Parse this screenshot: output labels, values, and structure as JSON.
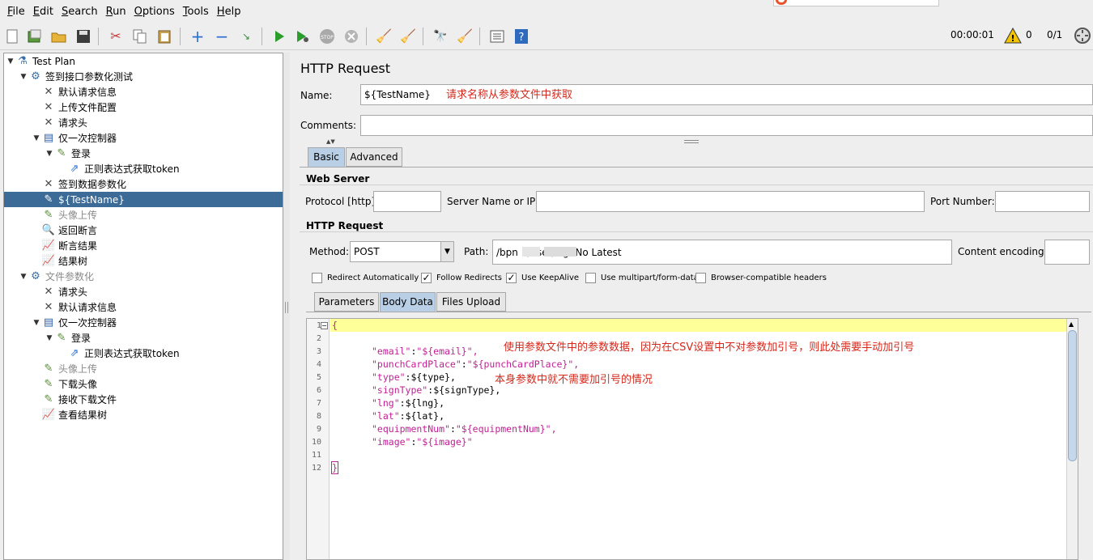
{
  "menu": [
    {
      "key": "F",
      "rest": "ile"
    },
    {
      "key": "E",
      "rest": "dit"
    },
    {
      "key": "S",
      "rest": "earch"
    },
    {
      "key": "R",
      "rest": "un"
    },
    {
      "key": "O",
      "rest": "ptions"
    },
    {
      "key": "T",
      "rest": "ools"
    },
    {
      "key": "H",
      "rest": "elp"
    }
  ],
  "toolbar": {
    "timer": "00:00:01",
    "warnings": "0",
    "threads": "0/1",
    "stop_label": "STOP"
  },
  "tree": [
    {
      "label": "Test Plan",
      "icon": "flask-icon",
      "glyph": "⚗",
      "toggle": "▼",
      "indent": 0
    },
    {
      "label": "签到接口参数化测试",
      "icon": "gear-icon",
      "glyph": "⚙",
      "toggle": "▼",
      "indent": 1
    },
    {
      "label": "默认请求信息",
      "icon": "wrench-icon",
      "glyph": "✕",
      "toggle": "",
      "indent": 2
    },
    {
      "label": "上传文件配置",
      "icon": "wrench-icon",
      "glyph": "✕",
      "toggle": "",
      "indent": 2
    },
    {
      "label": "请求头",
      "icon": "wrench-icon",
      "glyph": "✕",
      "toggle": "",
      "indent": 2
    },
    {
      "label": "仅一次控制器",
      "icon": "controller-icon",
      "glyph": "▤",
      "toggle": "▼",
      "indent": 2
    },
    {
      "label": "登录",
      "icon": "sampler-icon",
      "glyph": "✎",
      "toggle": "▼",
      "indent": 3
    },
    {
      "label": "正则表达式获取token",
      "icon": "extractor-icon",
      "glyph": "⇗",
      "toggle": "",
      "indent": 4
    },
    {
      "label": "签到数据参数化",
      "icon": "wrench-icon",
      "glyph": "✕",
      "toggle": "",
      "indent": 2
    },
    {
      "label": "${TestName}",
      "icon": "sampler-icon",
      "glyph": "✎",
      "toggle": "",
      "indent": 2,
      "selected": true
    },
    {
      "label": "头像上传",
      "icon": "sampler-icon",
      "glyph": "✎",
      "toggle": "",
      "indent": 2,
      "disabled": true
    },
    {
      "label": "返回断言",
      "icon": "magnifier-icon",
      "glyph": "🔍",
      "toggle": "",
      "indent": 2
    },
    {
      "label": "断言结果",
      "icon": "chart-icon",
      "glyph": "📈",
      "toggle": "",
      "indent": 2
    },
    {
      "label": "结果树",
      "icon": "chart-icon",
      "glyph": "📈",
      "toggle": "",
      "indent": 2
    },
    {
      "label": "文件参数化",
      "icon": "gear-icon",
      "glyph": "⚙",
      "toggle": "▼",
      "indent": 1,
      "disabled": true
    },
    {
      "label": "请求头",
      "icon": "wrench-icon",
      "glyph": "✕",
      "toggle": "",
      "indent": 2
    },
    {
      "label": "默认请求信息",
      "icon": "wrench-icon",
      "glyph": "✕",
      "toggle": "",
      "indent": 2
    },
    {
      "label": "仅一次控制器",
      "icon": "controller-icon",
      "glyph": "▤",
      "toggle": "▼",
      "indent": 2
    },
    {
      "label": "登录",
      "icon": "sampler-icon",
      "glyph": "✎",
      "toggle": "▼",
      "indent": 3
    },
    {
      "label": "正则表达式获取token",
      "icon": "extractor-icon",
      "glyph": "⇗",
      "toggle": "",
      "indent": 4
    },
    {
      "label": "头像上传",
      "icon": "sampler-icon",
      "glyph": "✎",
      "toggle": "",
      "indent": 2,
      "disabled": true
    },
    {
      "label": "下载头像",
      "icon": "sampler-icon",
      "glyph": "✎",
      "toggle": "",
      "indent": 2
    },
    {
      "label": "接收下载文件",
      "icon": "sampler-icon",
      "glyph": "✎",
      "toggle": "",
      "indent": 2
    },
    {
      "label": "查看结果树",
      "icon": "chart-icon",
      "glyph": "📈",
      "toggle": "",
      "indent": 2
    }
  ],
  "panel": {
    "title": "HTTP Request",
    "name_label": "Name:",
    "name_value": "${TestName}",
    "name_annotation": "请求名称从参数文件中获取",
    "comments_label": "Comments:",
    "comments_value": "",
    "tabs": [
      "Basic",
      "Advanced"
    ],
    "web_server_title": "Web Server",
    "protocol_label": "Protocol [http]:",
    "server_label": "Server Name or IP:",
    "port_label": "Port Number:",
    "protocol_value": "",
    "server_value": "",
    "port_value": "",
    "http_request_title": "HTTP Request",
    "method_label": "Method:",
    "method_value": "POST",
    "path_label": "Path:",
    "path_value": "/bpn        1/user/signNo  Latest",
    "encoding_label": "Content encoding:",
    "encoding_value": "",
    "checkboxes": [
      {
        "label": "Redirect Automatically",
        "checked": false
      },
      {
        "label": "Follow Redirects",
        "checked": true
      },
      {
        "label": "Use KeepAlive",
        "checked": true
      },
      {
        "label": "Use multipart/form-data",
        "checked": false
      },
      {
        "label": "Browser-compatible headers",
        "checked": false
      }
    ],
    "body_tabs": [
      "Parameters",
      "Body Data",
      "Files Upload"
    ]
  },
  "editor": {
    "line_numbers": [
      "1",
      "2",
      "3",
      "4",
      "5",
      "6",
      "7",
      "8",
      "9",
      "10",
      "11",
      "12"
    ],
    "lines": [
      {
        "key": "",
        "sep": "{",
        "val": ""
      },
      {
        "key": "",
        "sep": "",
        "val": ""
      },
      {
        "key": "\"email\"",
        "sep": ":",
        "val": "\"${email}\","
      },
      {
        "key": "\"punchCardPlace\"",
        "sep": ":",
        "val": "\"${punchCardPlace}\","
      },
      {
        "key": "\"type\"",
        "sep": ":",
        "val": "${type},"
      },
      {
        "key": "\"signType\"",
        "sep": ":",
        "val": "${signType},"
      },
      {
        "key": "\"lng\"",
        "sep": ":",
        "val": "${lng},"
      },
      {
        "key": "\"lat\"",
        "sep": ":",
        "val": "${lat},"
      },
      {
        "key": "\"equipmentNum\"",
        "sep": ":",
        "val": "\"${equipmentNum}\","
      },
      {
        "key": "\"image\"",
        "sep": ":",
        "val": "\"${image}\""
      },
      {
        "key": "",
        "sep": "",
        "val": ""
      },
      {
        "key": "",
        "sep": "}",
        "val": ""
      }
    ],
    "annotation_1": "使用参数文件中的参数数据，因为在CSV设置中不对参数加引号，则此处需要手动加引号",
    "annotation_2": "本身参数中就不需要加引号的情况"
  },
  "colors": {
    "selection": "#3c6b97",
    "annotation": "#d7281c",
    "json_key": "#c21e95",
    "current_line": "#ffff99",
    "active_tab": "#b8cfe5"
  }
}
